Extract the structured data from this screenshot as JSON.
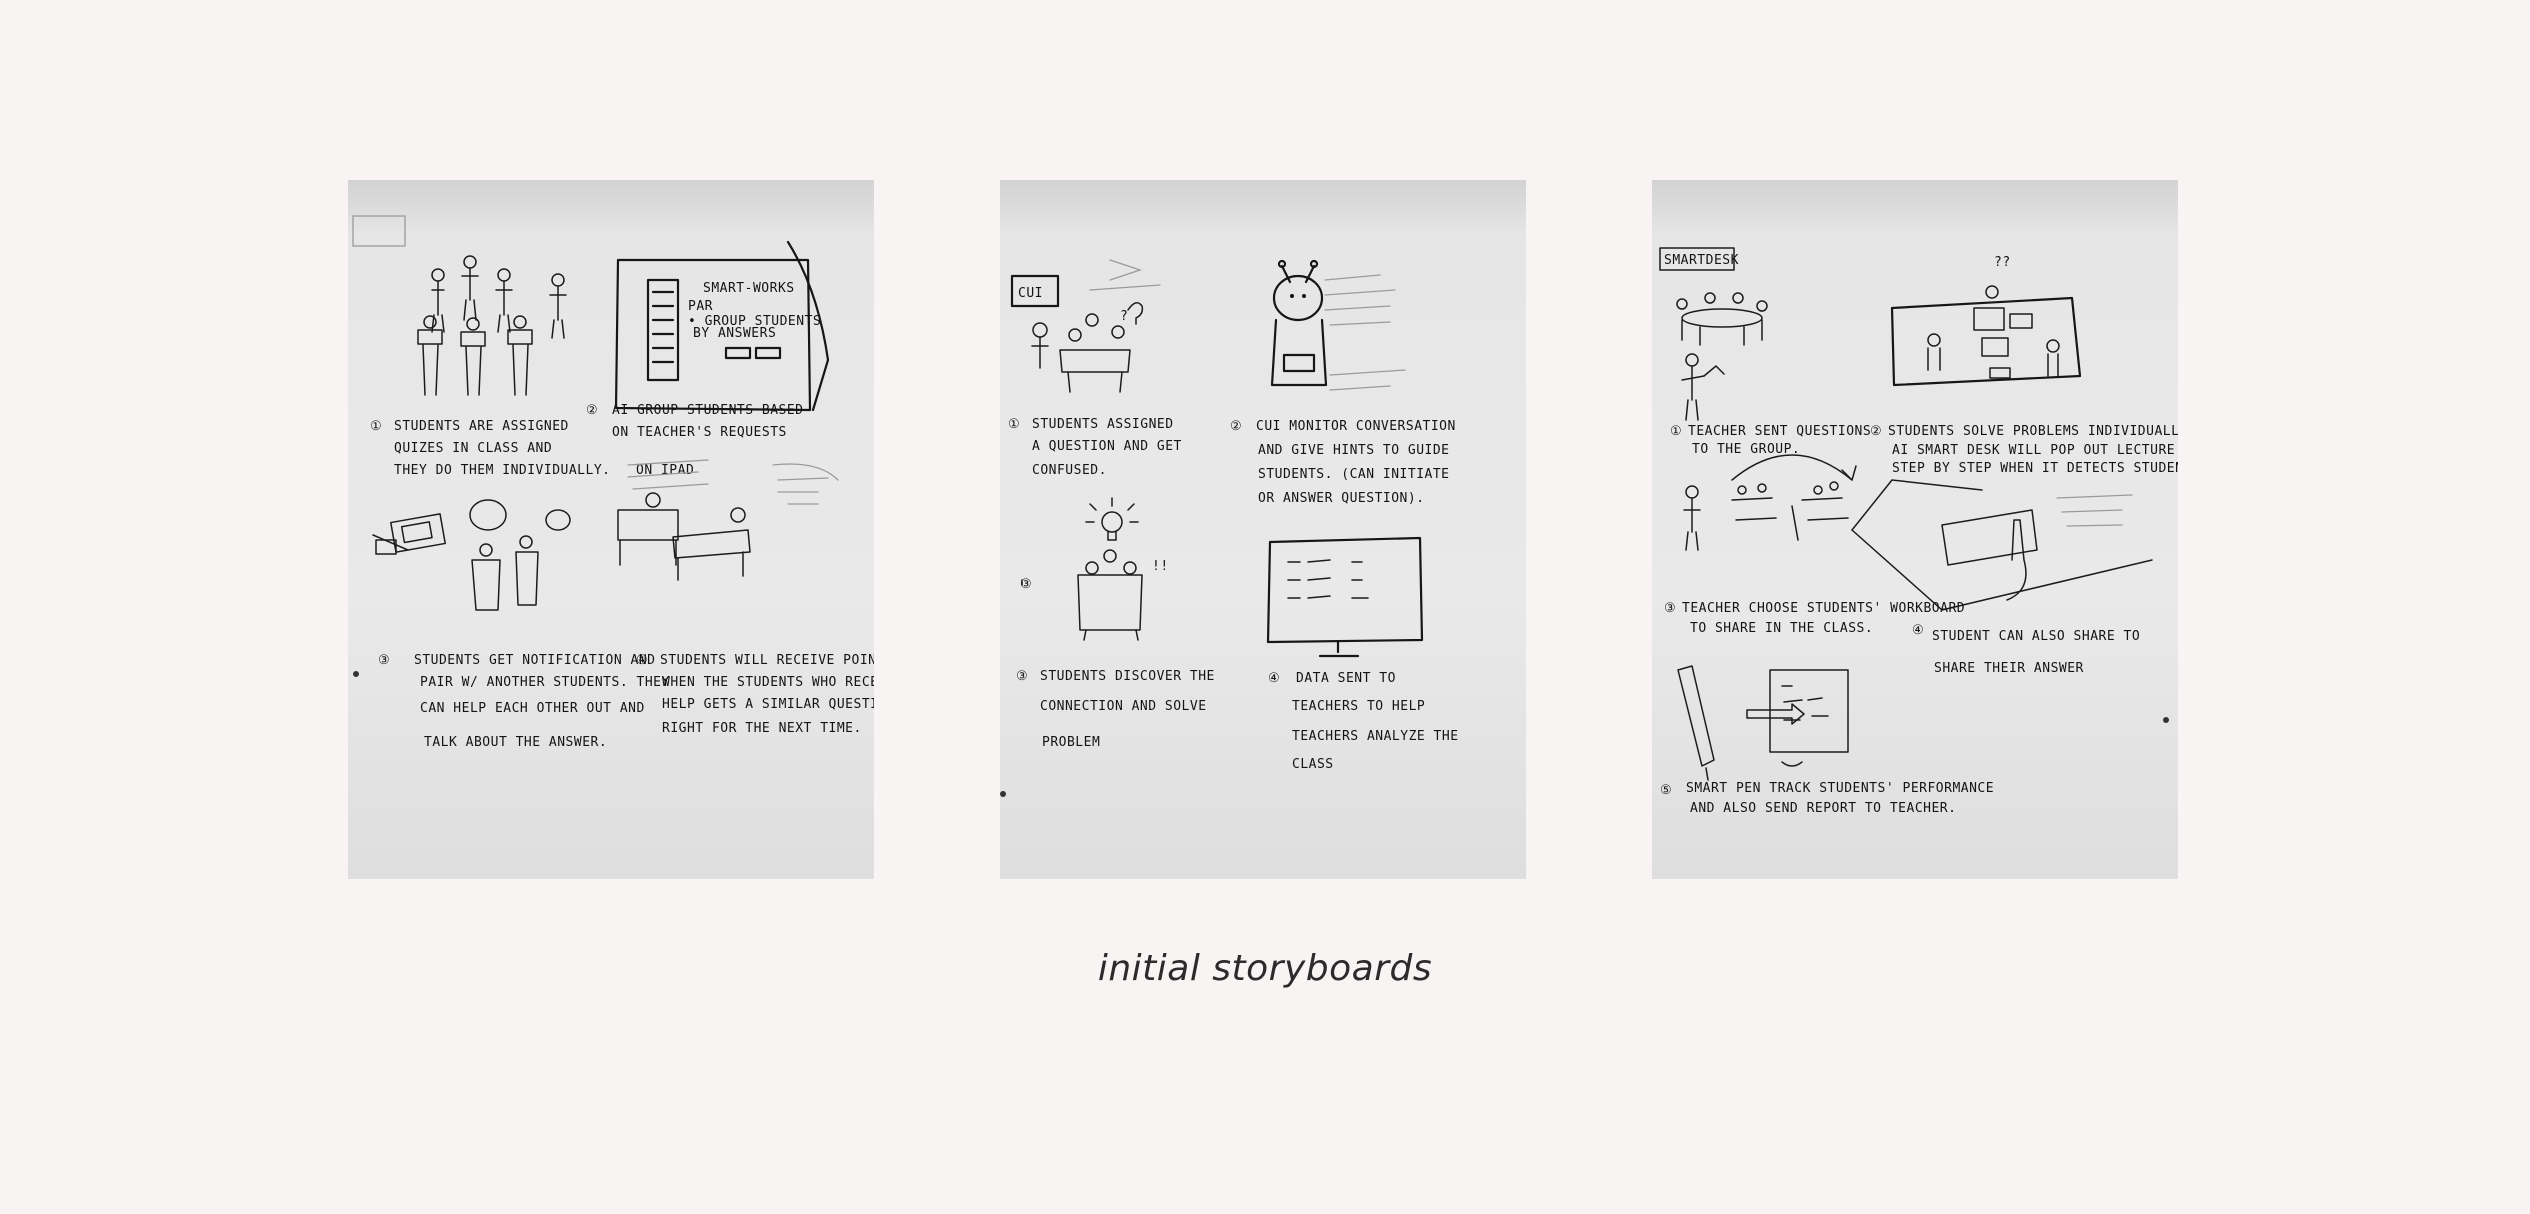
{
  "caption": "initial storyboards",
  "boards": [
    {
      "steps": [
        {
          "num": "①",
          "lines": [
            "STUDENTS ARE ASSIGNED",
            "QUIZES IN CLASS AND",
            "THEY DO THEM INDIVIDUALLY."
          ],
          "extra": "ON IPAD"
        },
        {
          "num": "②",
          "lines": [
            "AI GROUP STUDENTS BASED",
            "ON TEACHER'S REQUESTS"
          ]
        },
        {
          "num": "③",
          "lines": [
            "STUDENTS GET NOTIFICATION AND",
            "PAIR W/ ANOTHER STUDENTS. THEY",
            "CAN HELP EACH OTHER OUT AND",
            "TALK ABOUT THE ANSWER."
          ]
        },
        {
          "num": "④",
          "lines": [
            "STUDENTS WILL RECEIVE POINTS",
            "WHEN THE STUDENTS WHO RECEIVES",
            "HELP GETS A SIMILAR QUESTION",
            "RIGHT FOR THE NEXT TIME."
          ]
        }
      ]
    },
    {
      "label": "CUI",
      "steps": [
        {
          "num": "①",
          "lines": [
            "STUDENTS ASSIGNED",
            "A QUESTION AND GET",
            "CONFUSED."
          ]
        },
        {
          "num": "②",
          "lines": [
            "CUI MONITOR CONVERSATION",
            "AND GIVE HINTS TO GUIDE",
            "STUDENTS. (CAN INITIATE",
            "OR ANSWER QUESTION)."
          ]
        },
        {
          "num": "③",
          "lines": [
            "STUDENTS DISCOVER THE",
            "CONNECTION AND SOLVE",
            "PROBLEM"
          ]
        },
        {
          "num": "④",
          "lines": [
            "DATA SENT TO",
            "TEACHERS TO HELP",
            "TEACHERS ANALYZE THE",
            "CLASS"
          ]
        }
      ]
    },
    {
      "label": "SMARTDESK",
      "steps": [
        {
          "num": "①",
          "lines": [
            "TEACHER SENT QUESTIONS",
            "TO THE GROUP."
          ]
        },
        {
          "num": "②",
          "lines": [
            "STUDENTS SOLVE PROBLEMS INDIVIDUALLY.",
            "AI SMART DESK WILL POP OUT LECTURE NOTES / TEXTBOOK",
            "STEP BY STEP WHEN IT DETECTS STUDENT IS STRUGGLING."
          ]
        },
        {
          "num": "③",
          "lines": [
            "TEACHER CHOOSE STUDENTS' WORKBOARD",
            "TO SHARE IN THE CLASS."
          ]
        },
        {
          "num": "④",
          "lines": [
            "STUDENT CAN ALSO SHARE TO",
            "SHARE THEIR ANSWER"
          ]
        },
        {
          "num": "⑤",
          "lines": [
            "SMART PEN TRACK STUDENTS' PERFORMANCE",
            "AND ALSO SEND REPORT TO TEACHER."
          ]
        }
      ]
    }
  ]
}
